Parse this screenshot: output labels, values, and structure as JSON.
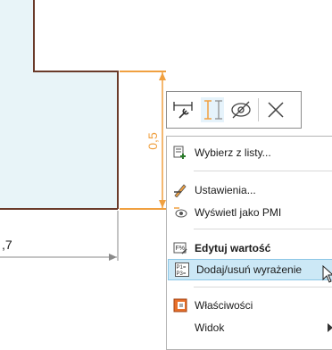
{
  "drawing": {
    "dimension_left_value": ",7",
    "dimension_vertical_value": "0,5",
    "colors": {
      "part_fill": "#e8f4f8",
      "part_edge": "#6a3a2a",
      "dimension_orange": "#f0a040",
      "dimension_gray": "#8a8a8a"
    }
  },
  "toolbar": {
    "buttons": [
      {
        "icon": "wrench-dimension-icon"
      },
      {
        "icon": "vertical-dimension-icon"
      },
      {
        "icon": "hide-eye-icon"
      },
      {
        "icon": "close-icon"
      }
    ]
  },
  "context_menu": {
    "items": [
      {
        "label": "Wybierz z listy...",
        "icon": "list-select-icon"
      },
      {
        "label": "Ustawienia...",
        "icon": "settings-pen-icon"
      },
      {
        "label": "Wyświetl jako PMI",
        "icon": "pmi-eye-icon"
      },
      {
        "label": "Edytuj wartość",
        "icon": "edit-value-icon",
        "bold": true
      },
      {
        "label": "Dodaj/usuń wyrażenie",
        "icon": "expression-icon",
        "hovered": true
      },
      {
        "label": "Właściwości",
        "icon": "properties-icon"
      },
      {
        "label": "Widok",
        "icon": "",
        "has_submenu": true
      }
    ]
  }
}
